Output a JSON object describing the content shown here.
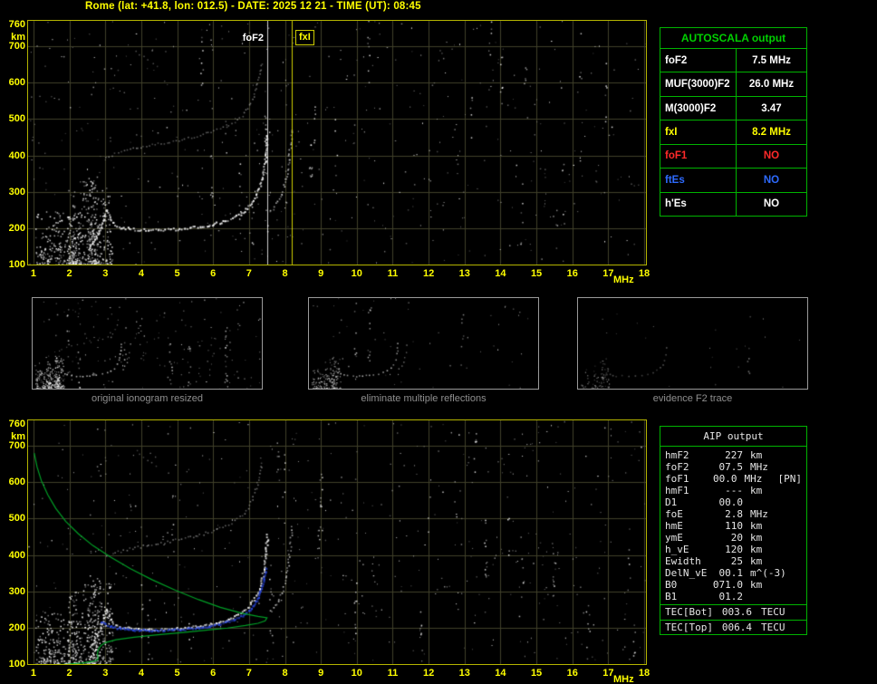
{
  "header": {
    "title": "Rome (lat: +41.8, lon: 012.5) - DATE: 2025 12 21 - TIME (UT): 08:45"
  },
  "colors": {
    "background": "#000000",
    "axis_text": "#ffff00",
    "plot_border": "#b4b400",
    "grid": "#40402a",
    "table_border": "#00b400",
    "autoscala_title": "#00d000",
    "aip_text": "#e6e6e6",
    "caption_text": "#8f8f8f",
    "profile_green": "#00a828",
    "fitted_blue": "#2b4bee",
    "trace_white": "#ffffff"
  },
  "autoscala_table": {
    "title": "AUTOSCALA output",
    "rows": [
      {
        "label": "foF2",
        "value": "7.5 MHz",
        "color": "#ffffff"
      },
      {
        "label": "MUF(3000)F2",
        "value": "26.0 MHz",
        "color": "#ffffff"
      },
      {
        "label": "M(3000)F2",
        "value": "3.47",
        "color": "#ffffff"
      },
      {
        "label": "fxI",
        "value": "8.2 MHz",
        "color": "#ffff00"
      },
      {
        "label": "foF1",
        "value": "NO",
        "color": "#ff2a2a"
      },
      {
        "label": "ftEs",
        "value": "NO",
        "color": "#2e6bff"
      },
      {
        "label": "h'Es",
        "value": "NO",
        "color": "#ffffff"
      }
    ]
  },
  "aip_table": {
    "title": "AIP output",
    "rows": [
      {
        "label": "hmF2",
        "value": "227",
        "unit": "km",
        "note": ""
      },
      {
        "label": "foF2",
        "value": "07.5",
        "unit": "MHz",
        "note": ""
      },
      {
        "label": "foF1",
        "value": "00.0",
        "unit": "MHz",
        "note": "[PN]"
      },
      {
        "label": "hmF1",
        "value": "---",
        "unit": "km",
        "note": ""
      },
      {
        "label": "D1",
        "value": "00.0",
        "unit": "",
        "note": ""
      },
      {
        "label": "foE",
        "value": "2.8",
        "unit": "MHz",
        "note": ""
      },
      {
        "label": "hmE",
        "value": "110",
        "unit": "km",
        "note": ""
      },
      {
        "label": "ymE",
        "value": "20",
        "unit": "km",
        "note": ""
      },
      {
        "label": "h_vE",
        "value": "120",
        "unit": "km",
        "note": ""
      },
      {
        "label": "Ewidth",
        "value": "25",
        "unit": "km",
        "note": ""
      },
      {
        "label": "DelN_vE",
        "value": "00.1",
        "unit": "m^(-3)",
        "note": ""
      },
      {
        "label": "B0",
        "value": "071.0",
        "unit": "km",
        "note": ""
      },
      {
        "label": "B1",
        "value": "01.2",
        "unit": "",
        "note": ""
      }
    ],
    "tec_rows": [
      {
        "label": "TEC[Bot]",
        "value": "003.6",
        "unit": "TECU"
      },
      {
        "label": "TEC[Top]",
        "value": "006.4",
        "unit": "TECU"
      }
    ]
  },
  "thumbnails": [
    {
      "caption": "original ionogram resized",
      "mode": "full"
    },
    {
      "caption": "eliminate multiple reflections",
      "mode": "no-multiples"
    },
    {
      "caption": "evidence F2 trace",
      "mode": "f2-only"
    }
  ],
  "chart_data": {
    "type": "scatter",
    "description": "Ionograms: virtual height (km) versus sounding frequency (MHz); white echo dots, green electron-density profile, blue autoscaled trace",
    "axes": {
      "xlabel": "MHz",
      "ylabel": "km",
      "xlim": [
        1,
        18
      ],
      "ylim": [
        100,
        760
      ],
      "xticks": [
        1,
        2,
        3,
        4,
        5,
        6,
        7,
        8,
        9,
        10,
        11,
        12,
        13,
        14,
        15,
        16,
        17,
        18
      ],
      "yticks": [
        760,
        700,
        600,
        500,
        400,
        300,
        200,
        100
      ],
      "grid": true
    },
    "traces": [
      {
        "name": "F2-trace-ordinary",
        "color": "#ffffff",
        "alpha": 0.95,
        "size": 2,
        "spacing": 2,
        "points": [
          [
            2.55,
            148
          ],
          [
            2.7,
            168
          ],
          [
            2.82,
            192
          ],
          [
            2.92,
            222
          ],
          [
            3.0,
            254
          ],
          [
            3.08,
            236
          ],
          [
            3.2,
            214
          ],
          [
            3.4,
            204
          ],
          [
            3.7,
            199
          ],
          [
            4.1,
            197
          ],
          [
            4.6,
            197
          ],
          [
            5.1,
            200
          ],
          [
            5.6,
            206
          ],
          [
            6.0,
            213
          ],
          [
            6.4,
            223
          ],
          [
            6.7,
            237
          ],
          [
            6.95,
            256
          ],
          [
            7.15,
            283
          ],
          [
            7.3,
            317
          ],
          [
            7.4,
            360
          ],
          [
            7.46,
            412
          ],
          [
            7.5,
            462
          ]
        ]
      },
      {
        "name": "F2-trace-extraordinary",
        "color": "#f0f0f0",
        "alpha": 0.8,
        "size": 1.7,
        "spacing": 3,
        "points": [
          [
            7.6,
            248
          ],
          [
            7.75,
            268
          ],
          [
            7.9,
            296
          ],
          [
            8.0,
            330
          ],
          [
            8.08,
            375
          ],
          [
            8.14,
            430
          ],
          [
            8.18,
            480
          ]
        ]
      },
      {
        "name": "second-hop-echo",
        "color": "#c8c8c8",
        "alpha": 0.6,
        "size": 1.6,
        "spacing": 3,
        "points": [
          [
            3.0,
            396
          ],
          [
            3.35,
            410
          ],
          [
            3.75,
            420
          ],
          [
            4.2,
            428
          ],
          [
            4.7,
            437
          ],
          [
            5.2,
            447
          ],
          [
            5.7,
            459
          ],
          [
            6.1,
            471
          ],
          [
            6.5,
            489
          ],
          [
            6.8,
            511
          ],
          [
            7.0,
            538
          ],
          [
            7.15,
            572
          ],
          [
            7.27,
            616
          ],
          [
            7.36,
            662
          ]
        ]
      },
      {
        "name": "third-hop-fragment",
        "color": "#b0b0b0",
        "alpha": 0.5,
        "size": 1.5,
        "spacing": 4,
        "points": [
          [
            3.85,
            686
          ],
          [
            4.05,
            672
          ],
          [
            4.3,
            656
          ],
          [
            4.55,
            640
          ]
        ]
      }
    ],
    "clusters": [
      {
        "name": "E-region-clutter",
        "f": [
          1.05,
          3.2
        ],
        "h": [
          100,
          248
        ],
        "count": 430,
        "bias_low": true
      },
      {
        "name": "noise-spike-2.0MHz",
        "f": [
          1.95,
          2.2
        ],
        "h": [
          100,
          305
        ],
        "count": 75,
        "bias_low": true
      },
      {
        "name": "noise-spike-2.65MHz",
        "f": [
          2.5,
          2.8
        ],
        "h": [
          100,
          345
        ],
        "count": 85,
        "bias_low": true
      },
      {
        "name": "cusp-scatter",
        "f": [
          2.35,
          3.15
        ],
        "h": [
          248,
          330
        ],
        "count": 45,
        "bias_low": false
      }
    ],
    "plots": [
      {
        "id": "top-ionogram",
        "markers": [
          {
            "name": "foF2",
            "f": 7.5,
            "color": "#ffffff"
          },
          {
            "name": "fxI",
            "f": 8.2,
            "color": "#ffff00"
          }
        ]
      },
      {
        "id": "bottom-ionogram",
        "profile": {
          "name": "electron-density-profile",
          "color": "#00a828",
          "points": [
            [
              1.02,
              680
            ],
            [
              1.1,
              642
            ],
            [
              1.22,
              604
            ],
            [
              1.4,
              565
            ],
            [
              1.62,
              528
            ],
            [
              1.9,
              492
            ],
            [
              2.25,
              458
            ],
            [
              2.65,
              426
            ],
            [
              3.15,
              394
            ],
            [
              3.7,
              362
            ],
            [
              4.3,
              332
            ],
            [
              4.95,
              303
            ],
            [
              5.6,
              277
            ],
            [
              6.2,
              256
            ],
            [
              6.8,
              240
            ],
            [
              7.25,
              231
            ],
            [
              7.5,
              227
            ],
            [
              7.45,
              219
            ],
            [
              7.25,
              212
            ],
            [
              6.9,
              206
            ],
            [
              6.4,
              199
            ],
            [
              5.8,
              193
            ],
            [
              5.1,
              186
            ],
            [
              4.4,
              180
            ],
            [
              3.8,
              174
            ],
            [
              3.3,
              167
            ],
            [
              3.0,
              159
            ],
            [
              2.88,
              151
            ],
            [
              2.82,
              143
            ],
            [
              2.79,
              135
            ],
            [
              2.78,
              128
            ],
            [
              2.79,
              122
            ],
            [
              2.8,
              116
            ],
            [
              2.78,
              111
            ],
            [
              2.65,
              107
            ],
            [
              2.35,
              103
            ],
            [
              1.95,
              100
            ],
            [
              1.55,
              98
            ]
          ]
        },
        "fitted_trace": {
          "name": "autoscala-fitted-trace",
          "color": "#2b4bee",
          "points": [
            [
              2.85,
              222
            ],
            [
              3.05,
              212
            ],
            [
              3.3,
              205
            ],
            [
              3.7,
              200
            ],
            [
              4.2,
              198
            ],
            [
              4.7,
              199
            ],
            [
              5.2,
              202
            ],
            [
              5.7,
              207
            ],
            [
              6.1,
              214
            ],
            [
              6.5,
              225
            ],
            [
              6.8,
              239
            ],
            [
              7.05,
              259
            ],
            [
              7.25,
              289
            ],
            [
              7.38,
              328
            ],
            [
              7.45,
              372
            ]
          ]
        }
      }
    ]
  }
}
